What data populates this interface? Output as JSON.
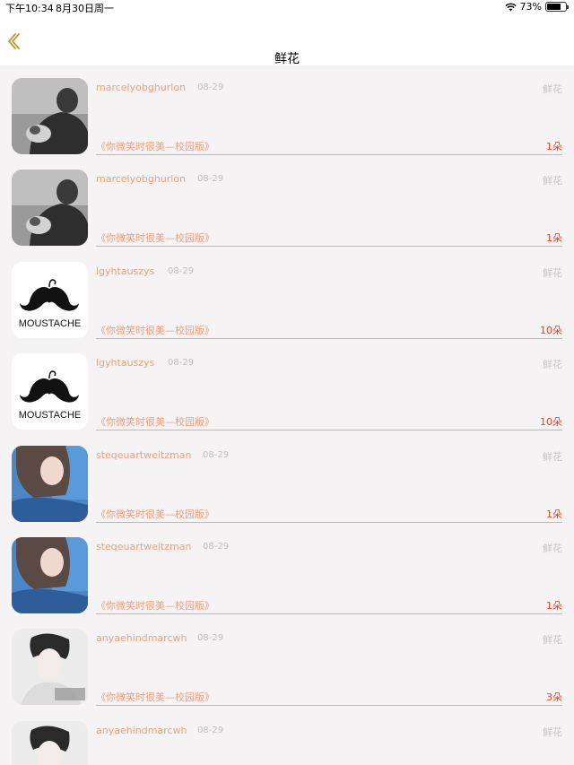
{
  "status_bar": {
    "time": "下午10:34",
    "date": "8月30日周一",
    "battery": "73%",
    "battery_level": 0.73
  },
  "nav": {
    "title": "鲜花",
    "back_icon": "chevron-left-icon"
  },
  "colors": {
    "username": "#e8a07a",
    "count": "#e0452d",
    "secondary": "#c4c4c4",
    "back_icon": "#b8a030"
  },
  "records": [
    {
      "user": "marcelyobghurlon",
      "date": "08-29",
      "gift": "鲜花",
      "song": "《你微笑时很美—校园版》",
      "count": "1朵",
      "avatar": "man-photo-avatar"
    },
    {
      "user": "marcelyobghurlon",
      "date": "08-29",
      "gift": "鲜花",
      "song": "《你微笑时很美—校园版》",
      "count": "1朵",
      "avatar": "man-photo-avatar"
    },
    {
      "user": "lgyhtauszys",
      "date": "08-29",
      "gift": "鲜花",
      "song": "《你微笑时很美—校园版》",
      "count": "10朵",
      "avatar": "moustache-logo-avatar",
      "avatar_text": "MOUSTACHE"
    },
    {
      "user": "lgyhtauszys",
      "date": "08-29",
      "gift": "鲜花",
      "song": "《你微笑时很美—校园版》",
      "count": "10朵",
      "avatar": "moustache-logo-avatar",
      "avatar_text": "MOUSTACHE"
    },
    {
      "user": "steqeuartweitzman",
      "date": "08-29",
      "gift": "鲜花",
      "song": "《你微笑时很美—校园版》",
      "count": "1朵",
      "avatar": "girl-photo-avatar"
    },
    {
      "user": "steqeuartweitzman",
      "date": "08-29",
      "gift": "鲜花",
      "song": "《你微笑时很美—校园版》",
      "count": "1朵",
      "avatar": "girl-photo-avatar"
    },
    {
      "user": "anyaehindmarcwh",
      "date": "08-29",
      "gift": "鲜花",
      "song": "《你微笑时很美—校园版》",
      "count": "3朵",
      "avatar": "boy-photo-avatar"
    },
    {
      "user": "anyaehindmarcwh",
      "date": "08-29",
      "gift": "鲜花",
      "song": "",
      "count": "",
      "avatar": "boy-photo-avatar"
    }
  ]
}
